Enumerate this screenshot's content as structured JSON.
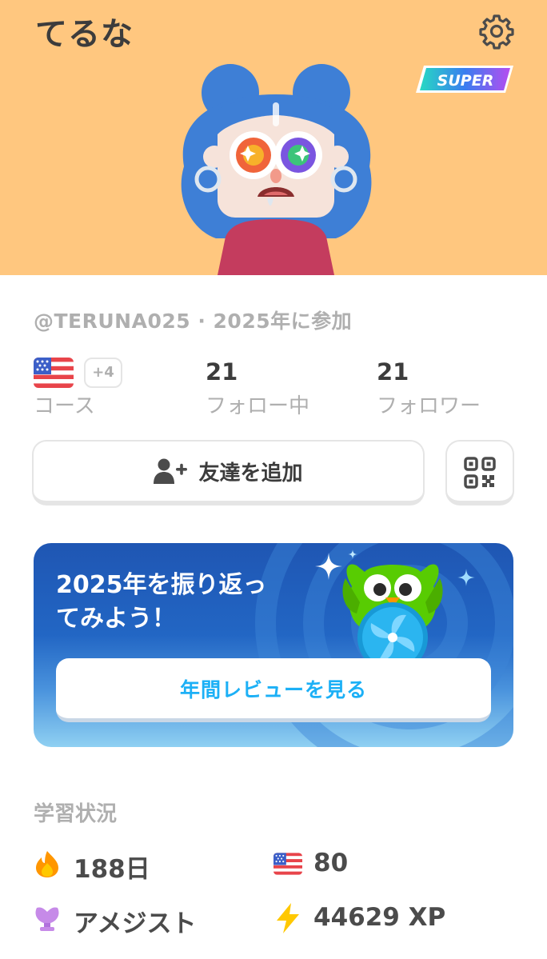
{
  "profile": {
    "display_name": "てるな",
    "badge": "SUPER",
    "handle_line": "@TERUNA025 · 2025年に参加"
  },
  "stats": {
    "courses_extra": "+4",
    "courses_label": "コース",
    "following_count": "21",
    "following_label": "フォロー中",
    "followers_count": "21",
    "followers_label": "フォロワー"
  },
  "actions": {
    "add_friend_label": "友達を追加"
  },
  "promo": {
    "title": "2025年を振り返っ\nてみよう！",
    "button_label": "年間レビューを見る"
  },
  "learning": {
    "section_title": "学習状況",
    "streak": "188日",
    "course_score": "80",
    "league": "アメジスト",
    "xp": "44629 XP"
  },
  "colors": {
    "header_bg": "#FFC77F",
    "accent_blue": "#1CB0F6",
    "hair_blue": "#3E7FD6",
    "amethyst": "#C68AE8",
    "xp_yellow": "#FFC800",
    "streak_orange": "#FF9600"
  },
  "icons": [
    "gear-icon",
    "super-badge",
    "us-flag-icon",
    "add-user-icon",
    "qr-code-icon",
    "fire-icon",
    "trophy-icon",
    "lightning-icon"
  ]
}
